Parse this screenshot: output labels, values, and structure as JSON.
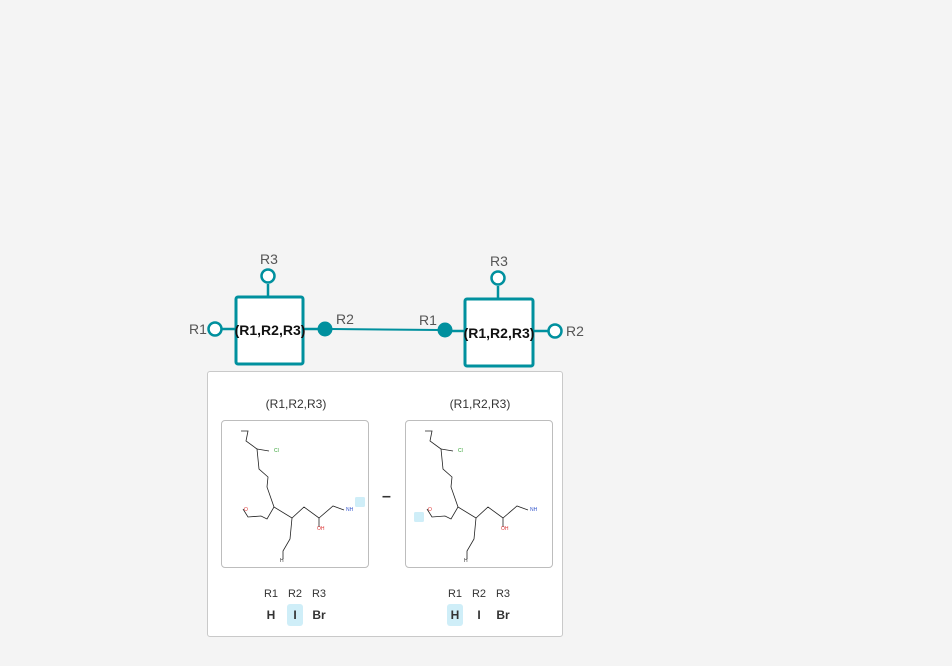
{
  "colors": {
    "accent": "#00909e",
    "highlight": "#cfeef8",
    "panel_border": "#c9c9c9"
  },
  "monomers": [
    {
      "label": "(R1,R2,R3)",
      "rgroups": [
        "R1",
        "R2",
        "R3"
      ]
    },
    {
      "label": "(R1,R2,R3)",
      "rgroups": [
        "R1",
        "R2",
        "R3"
      ]
    }
  ],
  "connection": {
    "from_rgroup": "R2",
    "to_rgroup": "R1"
  },
  "panel": {
    "cards": [
      {
        "title": "(R1,R2,R3)",
        "atoms": {
          "cl": "Cl",
          "o": "O",
          "oh": "OH",
          "nh": "NH",
          "h": "H"
        },
        "rgroup_headers": [
          "R1",
          "R2",
          "R3"
        ],
        "rgroup_values": [
          "H",
          "I",
          "Br"
        ],
        "selected_index": 1
      },
      {
        "title": "(R1,R2,R3)",
        "atoms": {
          "cl": "Cl",
          "o": "O",
          "oh": "OH",
          "nh": "NH",
          "h": "H"
        },
        "rgroup_headers": [
          "R1",
          "R2",
          "R3"
        ],
        "rgroup_values": [
          "H",
          "I",
          "Br"
        ],
        "selected_index": 0
      }
    ],
    "separator": "–"
  }
}
